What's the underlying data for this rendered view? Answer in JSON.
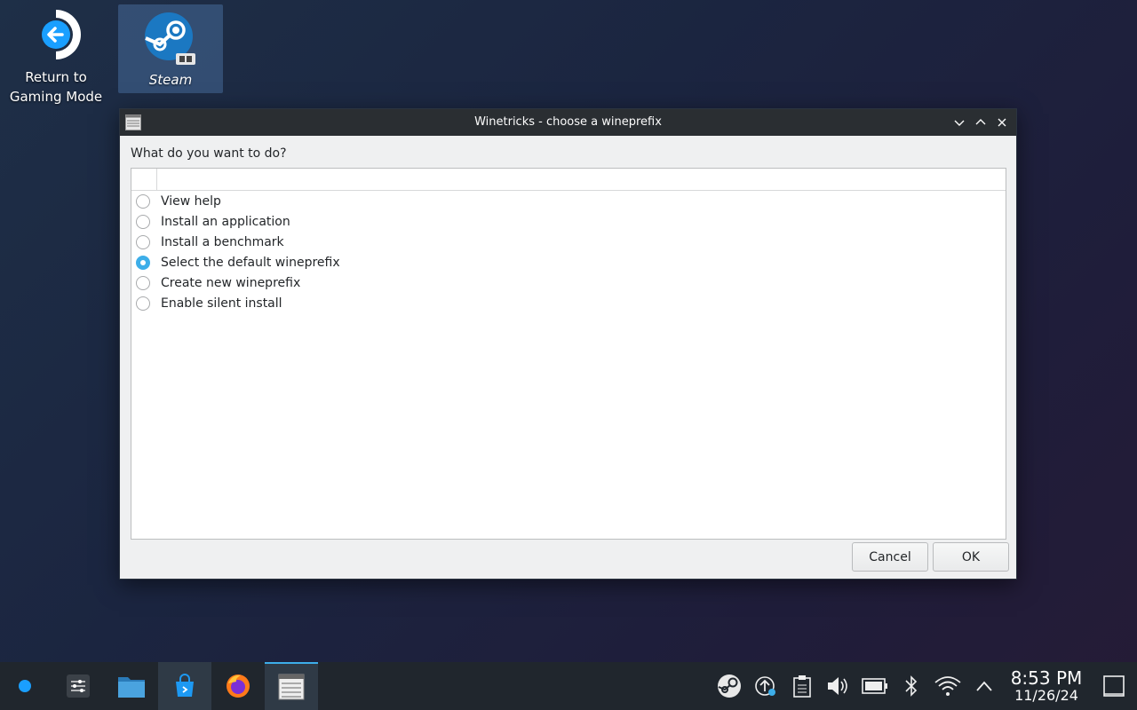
{
  "desktop": {
    "icons": [
      {
        "label_line1": "Return to",
        "label_line2": "Gaming Mode",
        "icon": "return-arrow-icon"
      },
      {
        "label": "Steam",
        "icon": "steam-icon"
      }
    ]
  },
  "window": {
    "title": "Winetricks - choose a wineprefix",
    "prompt": "What do you want to do?",
    "options": [
      {
        "label": "View help",
        "checked": false
      },
      {
        "label": "Install an application",
        "checked": false
      },
      {
        "label": "Install a benchmark",
        "checked": false
      },
      {
        "label": "Select the default wineprefix",
        "checked": true
      },
      {
        "label": "Create new wineprefix",
        "checked": false
      },
      {
        "label": "Enable silent install",
        "checked": false
      }
    ],
    "buttons": {
      "cancel": "Cancel",
      "ok": "OK"
    }
  },
  "taskbar": {
    "apps": [
      "steam-deck-launcher-icon",
      "settings-sliders-icon",
      "file-manager-icon",
      "discover-store-icon",
      "firefox-icon",
      "winetricks-window-icon"
    ],
    "tray": [
      "steam-tray-icon",
      "updates-icon",
      "clipboard-icon",
      "volume-icon",
      "battery-icon",
      "bluetooth-icon",
      "wifi-icon",
      "expand-tray-icon"
    ],
    "clock": {
      "time": "8:53 PM",
      "date": "11/26/24"
    }
  },
  "colors": {
    "accent": "#3daee9",
    "titlebar": "#2a2e32",
    "taskbar": "#20262d"
  }
}
